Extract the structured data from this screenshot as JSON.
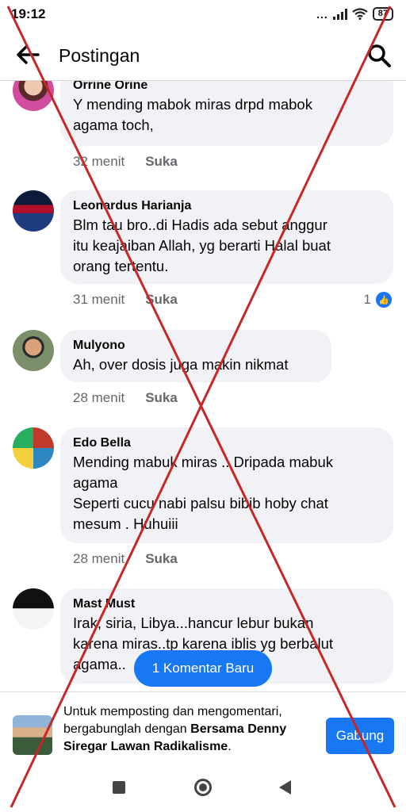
{
  "status_bar": {
    "time": "19:12",
    "battery": "87",
    "signal_dots": "...",
    "icons": [
      "signal-icon",
      "wifi-icon",
      "battery-icon"
    ]
  },
  "header": {
    "title": "Postingan",
    "back_icon": "arrow-left-icon",
    "search_icon": "search-icon"
  },
  "comments": [
    {
      "author": "Orrine Orine",
      "text": "Y mending mabok miras drpd mabok\nagama toch,",
      "time": "32 menit",
      "like_label": "Suka",
      "reactions": ""
    },
    {
      "author": "Leonardus Harianja",
      "text": "Blm tau bro..di Hadis ada sebut anggur\nitu keajaiban Allah, yg berarti Halal buat\norang tertentu.",
      "time": "31 menit",
      "like_label": "Suka",
      "reactions": "1"
    },
    {
      "author": "Mulyono",
      "text": "Ah, over dosis juga makin nikmat",
      "time": "28 menit",
      "like_label": "Suka",
      "reactions": ""
    },
    {
      "author": "Edo Bella",
      "text": "Mending mabuk miras .. Dripada mabuk\nagama\nSeperti cucu nabi palsu bibib hoby chat\nmesum . Huhuiii",
      "time": "28 menit",
      "like_label": "Suka",
      "reactions": ""
    },
    {
      "author": "Mast Must",
      "text": "Irak, siria, Libya...hancur lebur bukan\nkarena miras..tp karena iblis yg berbalut\nagama..",
      "time": "",
      "like_label": "",
      "reactions": ""
    }
  ],
  "new_comments_pill": "1 Komentar Baru",
  "join_bar": {
    "text_before": "Untuk memposting dan mengomentari, bergabunglah dengan ",
    "group_name": "Bersama Denny Siregar Lawan Radikalisme",
    "text_after": ".",
    "button_label": "Gabung"
  },
  "colors": {
    "accent": "#1877f2",
    "bubble": "#f0f2f5",
    "secondary_text": "#65676b",
    "overlay_cross": "#c62828"
  }
}
